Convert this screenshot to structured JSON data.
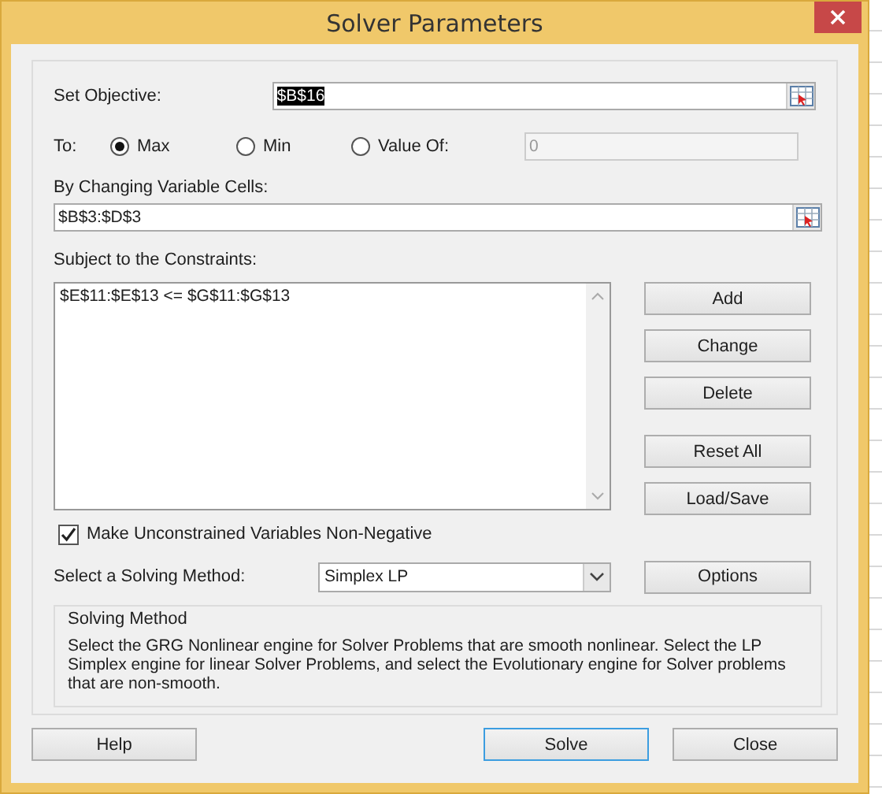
{
  "window": {
    "title": "Solver Parameters"
  },
  "objective": {
    "label": "Set Objective:",
    "value": "$B$16",
    "text_selected": true
  },
  "to": {
    "label": "To:",
    "options": [
      {
        "label": "Max",
        "selected": true
      },
      {
        "label": "Min",
        "selected": false
      },
      {
        "label": "Value Of:",
        "selected": false
      }
    ]
  },
  "value_of": {
    "value": "0",
    "disabled": true
  },
  "changing_cells": {
    "label": "By Changing Variable Cells:",
    "value": "$B$3:$D$3"
  },
  "constraints": {
    "label": "Subject to the Constraints:",
    "items": [
      "$E$11:$E$13 <= $G$11:$G$13"
    ]
  },
  "constraint_buttons": [
    [
      "Add",
      "Change",
      "Delete"
    ],
    [
      "Reset All",
      "Load/Save"
    ]
  ],
  "non_negative": {
    "label": "Make Unconstrained Variables Non-Negative",
    "checked": true
  },
  "method": {
    "label": "Select a Solving Method:",
    "value": "Simplex LP"
  },
  "options_button": "Options",
  "info": {
    "title": "Solving Method",
    "text": "Select the GRG Nonlinear engine for Solver Problems that are smooth nonlinear. Select the LP Simplex engine for linear Solver Problems, and select the Evolutionary engine for Solver problems that are non-smooth."
  },
  "footer_buttons": [
    {
      "label": "Help",
      "default": false
    },
    {
      "label": "Solve",
      "default": true
    },
    {
      "label": "Close",
      "default": false
    }
  ]
}
